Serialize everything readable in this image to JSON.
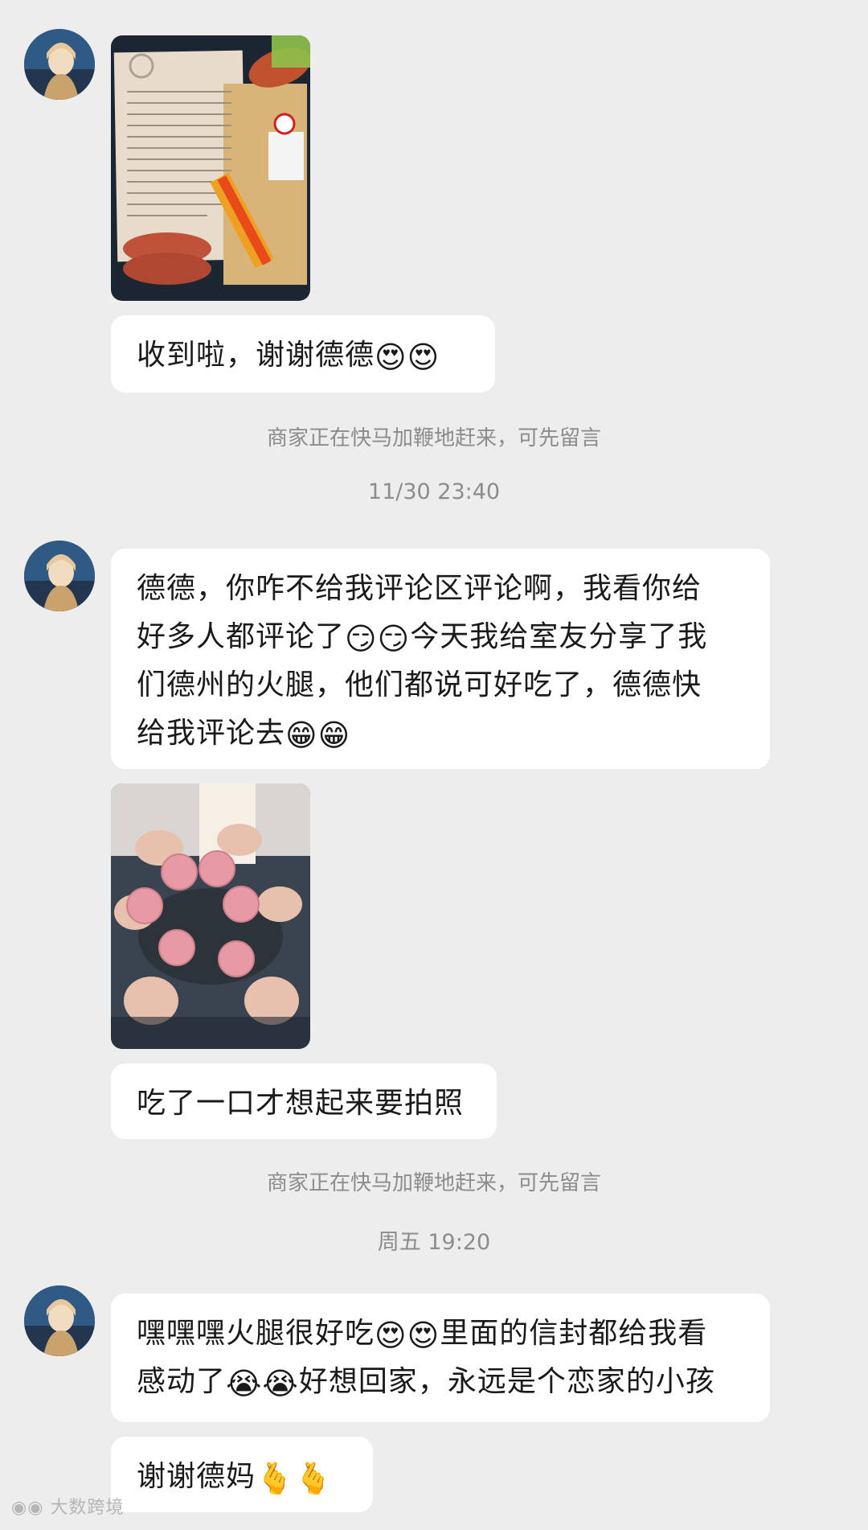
{
  "messages": {
    "m1_text": "收到啦，谢谢德德",
    "m2_line1": "德德，你咋不给我评论区评论啊，我看你给",
    "m2_line2_a": "好多人都评论了",
    "m2_line2_b": "今天我给室友分享了我",
    "m2_line3": "们德州的火腿，他们都说可好吃了，德德快",
    "m2_line4": "给我评论去",
    "m3_text": "吃了一口才想起来要拍照",
    "m4_line1_a": "嘿嘿嘿火腿很好吃",
    "m4_line1_b": "里面的信封都给我看",
    "m4_line2_a": "感动了",
    "m4_line2_b": "好想回家，永远是个恋家的小孩",
    "m5_text": "谢谢德妈"
  },
  "emoji": {
    "heart_eyes_kiss": "😍",
    "smug": "😏",
    "grin": "😁",
    "crying": "😭",
    "finger_heart": "🫰"
  },
  "system": {
    "merchant_notice": "商家正在快马加鞭地赶来，可先留言"
  },
  "timestamps": {
    "t1": "11/30 23:40",
    "t2": "周五 19:20"
  },
  "watermark": "大数跨境"
}
